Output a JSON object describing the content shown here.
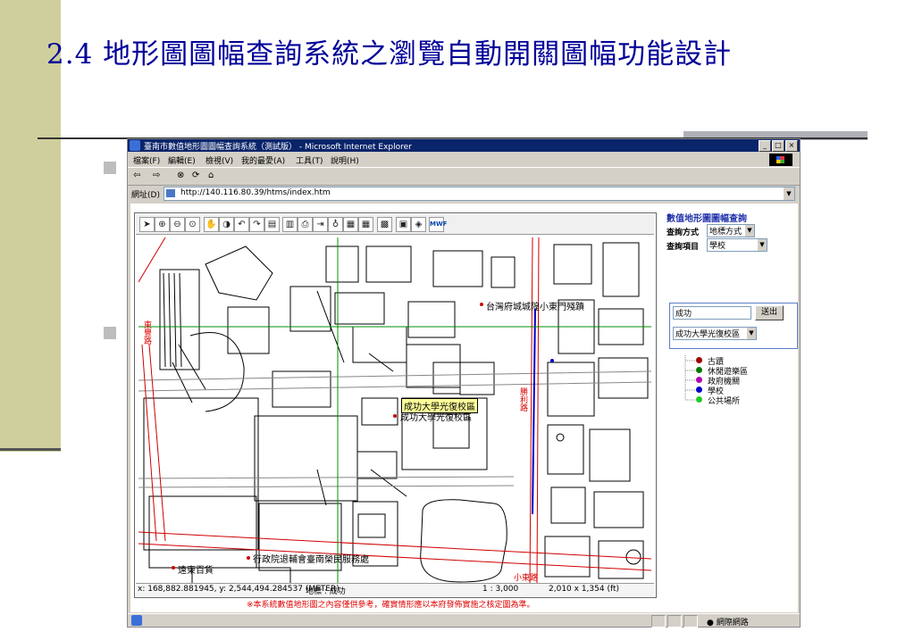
{
  "slide": {
    "title": "2.4 地形圖圖幅查詢系統之瀏覽自動開關圖幅功能設計"
  },
  "browser": {
    "window_title": "臺南市數值地形圖圖幅查詢系統（測試版） - Microsoft Internet Explorer",
    "menu": [
      "檔案(F)",
      "編輯(E)",
      "檢視(V)",
      "我的最愛(A)",
      "工具(T)",
      "說明(H)"
    ],
    "nav": {
      "back": "⇦",
      "forward": "⇨",
      "stop": "⊗",
      "refresh": "⟳",
      "home": "⌂"
    },
    "address_label": "網址(D)",
    "address_url": "http://140.116.80.39/htms/index.htm",
    "status_zone": "網際網路"
  },
  "map": {
    "labels": {
      "temple": "台灣府城城隍小東門殘蹟",
      "highlight": "成功大學光復校區",
      "under": "成功大學光復校區",
      "office": "行政院退輔會臺南榮民服務處",
      "dept": "遠東百貨",
      "road_left": "東豐路",
      "road_mid": "勝利路",
      "road_bottom": "小東路"
    },
    "status": {
      "coords": "x: 168,882.881945, y: 2,544,494.284537 (METER)",
      "feature": "地標 : 成功",
      "scale": "1 : 3,000",
      "size": "2,010 x 1,354 (ft)"
    }
  },
  "panel": {
    "title": "數值地形圖圖幅查詢",
    "query_mode_label": "查詢方式",
    "query_mode_value": "地標方式",
    "query_item_label": "查詢項目",
    "query_item_value": "學校",
    "search_value": "成功",
    "search_button": "送出",
    "result_value": "成功大學光復校區",
    "legend": [
      {
        "label": "古蹟",
        "color": "#a00000"
      },
      {
        "label": "休閒遊樂區",
        "color": "#007a00"
      },
      {
        "label": "政府機關",
        "color": "#b000b0"
      },
      {
        "label": "學校",
        "color": "#0000cc"
      },
      {
        "label": "公共場所",
        "color": "#22cc22"
      }
    ],
    "disclaimer": "※本系統數值地形圖之內容僅供參考，確實情形應以本府發佈實施之核定圖為準。"
  }
}
